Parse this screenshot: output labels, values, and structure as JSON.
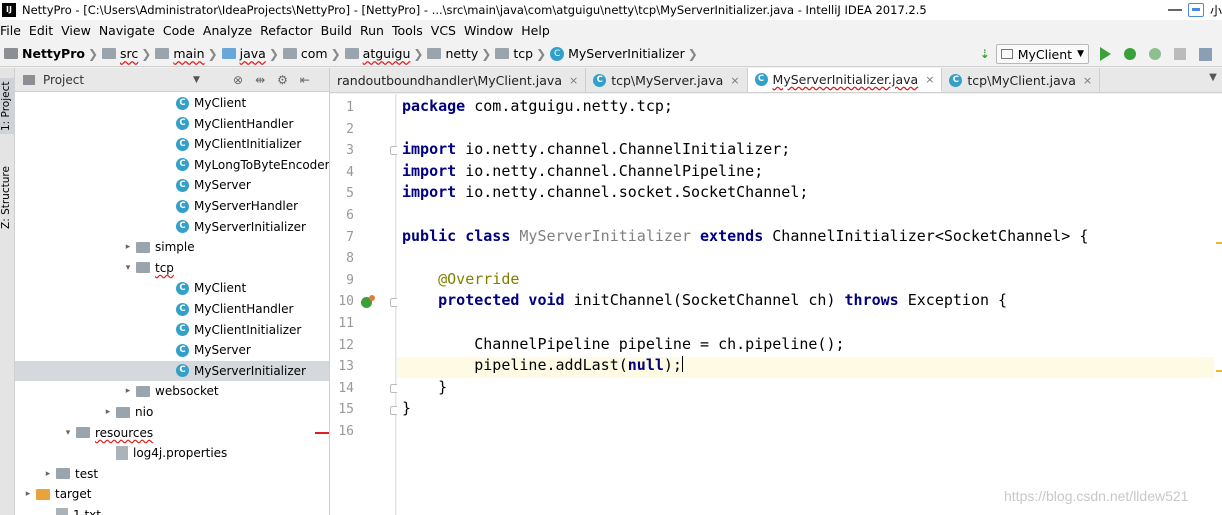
{
  "window": {
    "app_icon": "IJ",
    "title": "NettyPro - [C:\\Users\\Administrator\\IdeaProjects\\NettyPro] - [NettyPro] - ...\\src\\main\\java\\com\\atguigu\\netty\\tcp\\MyServerInitializer.java - IntelliJ IDEA 2017.2.5",
    "tray_text": "小"
  },
  "menu": [
    "File",
    "Edit",
    "View",
    "Navigate",
    "Code",
    "Analyze",
    "Refactor",
    "Build",
    "Run",
    "Tools",
    "VCS",
    "Window",
    "Help"
  ],
  "breadcrumbs": [
    "NettyPro",
    "src",
    "main",
    "java",
    "com",
    "atguigu",
    "netty",
    "tcp",
    "MyServerInitializer"
  ],
  "toolbar": {
    "run_config": "MyClient"
  },
  "left_strip": {
    "project_tab": "1: Project",
    "structure_tab": "Z: Structure"
  },
  "project_panel": {
    "title": "Project",
    "rows": [
      {
        "label": "MyClient",
        "kind": "class-run",
        "indent": 161
      },
      {
        "label": "MyClientHandler",
        "kind": "class",
        "indent": 161
      },
      {
        "label": "MyClientInitializer",
        "kind": "class",
        "indent": 161
      },
      {
        "label": "MyLongToByteEncoder",
        "kind": "class",
        "indent": 161
      },
      {
        "label": "MyServer",
        "kind": "class-run",
        "indent": 161
      },
      {
        "label": "MyServerHandler",
        "kind": "class",
        "indent": 161
      },
      {
        "label": "MyServerInitializer",
        "kind": "class",
        "indent": 161
      },
      {
        "label": "simple",
        "kind": "folder-collapsed",
        "indent": 121
      },
      {
        "label": "tcp",
        "kind": "folder-expanded",
        "indent": 121
      },
      {
        "label": "MyClient",
        "kind": "class-run",
        "indent": 161
      },
      {
        "label": "MyClientHandler",
        "kind": "class",
        "indent": 161
      },
      {
        "label": "MyClientInitializer",
        "kind": "class",
        "indent": 161
      },
      {
        "label": "MyServer",
        "kind": "class-run",
        "indent": 161
      },
      {
        "label": "MyServerInitializer",
        "kind": "class",
        "indent": 161,
        "selected": true
      },
      {
        "label": "websocket",
        "kind": "folder-collapsed",
        "indent": 121
      },
      {
        "label": "nio",
        "kind": "folder-collapsed",
        "indent": 101
      },
      {
        "label": "resources",
        "kind": "folder-res-expanded",
        "indent": 61
      },
      {
        "label": "log4j.properties",
        "kind": "file",
        "indent": 101
      },
      {
        "label": "test",
        "kind": "folder-collapsed",
        "indent": 41
      },
      {
        "label": "target",
        "kind": "folder-target-collapsed",
        "indent": 21
      },
      {
        "label": "1.txt",
        "kind": "file",
        "indent": 41
      }
    ]
  },
  "editor_tabs": [
    {
      "label": "randoutboundhandler\\MyClient.java",
      "active": false,
      "icon": false
    },
    {
      "label": "tcp\\MyServer.java",
      "active": false,
      "icon": true
    },
    {
      "label": "MyServerInitializer.java",
      "active": true,
      "icon": true
    },
    {
      "label": "tcp\\MyClient.java",
      "active": false,
      "icon": true
    }
  ],
  "code": {
    "line_numbers": [
      "1",
      "2",
      "3",
      "4",
      "5",
      "6",
      "7",
      "8",
      "9",
      "10",
      "11",
      "12",
      "13",
      "14",
      "15",
      "16"
    ],
    "lines": [
      [
        {
          "t": "package",
          "c": "kw"
        },
        {
          "t": " com.atguigu.netty.tcp;",
          "c": ""
        }
      ],
      [],
      [
        {
          "t": "import",
          "c": "kw"
        },
        {
          "t": " io.netty.channel.ChannelInitializer;",
          "c": ""
        }
      ],
      [
        {
          "t": "import",
          "c": "kw"
        },
        {
          "t": " io.netty.channel.ChannelPipeline;",
          "c": ""
        }
      ],
      [
        {
          "t": "import",
          "c": "kw"
        },
        {
          "t": " io.netty.channel.socket.SocketChannel;",
          "c": ""
        }
      ],
      [],
      [
        {
          "t": "public class",
          "c": "kw"
        },
        {
          "t": " ",
          "c": ""
        },
        {
          "t": "MyServerInitializer",
          "c": "gray"
        },
        {
          "t": " ",
          "c": ""
        },
        {
          "t": "extends",
          "c": "kw"
        },
        {
          "t": " ChannelInitializer<SocketChannel> {",
          "c": ""
        }
      ],
      [],
      [
        {
          "t": "    ",
          "c": ""
        },
        {
          "t": "@Override",
          "c": "ann"
        }
      ],
      [
        {
          "t": "    ",
          "c": ""
        },
        {
          "t": "protected void",
          "c": "kw"
        },
        {
          "t": " initChannel(SocketChannel ch) ",
          "c": ""
        },
        {
          "t": "throws",
          "c": "kw"
        },
        {
          "t": " Exception {",
          "c": ""
        }
      ],
      [],
      [
        {
          "t": "        ChannelPipeline pipeline = ch.pipeline();",
          "c": ""
        }
      ],
      [
        {
          "t": "        pipeline.addLast(",
          "c": ""
        },
        {
          "t": "null",
          "c": "kw"
        },
        {
          "t": ");",
          "c": ""
        }
      ],
      [
        {
          "t": "    }",
          "c": ""
        }
      ],
      [
        {
          "t": "}",
          "c": ""
        }
      ],
      []
    ]
  },
  "watermark": "https://blog.csdn.net/lldew521",
  "colors": {
    "keyword": "#000080",
    "annotation": "#808000",
    "class_icon": "#33a0c9",
    "run_green": "#3aa13a"
  }
}
